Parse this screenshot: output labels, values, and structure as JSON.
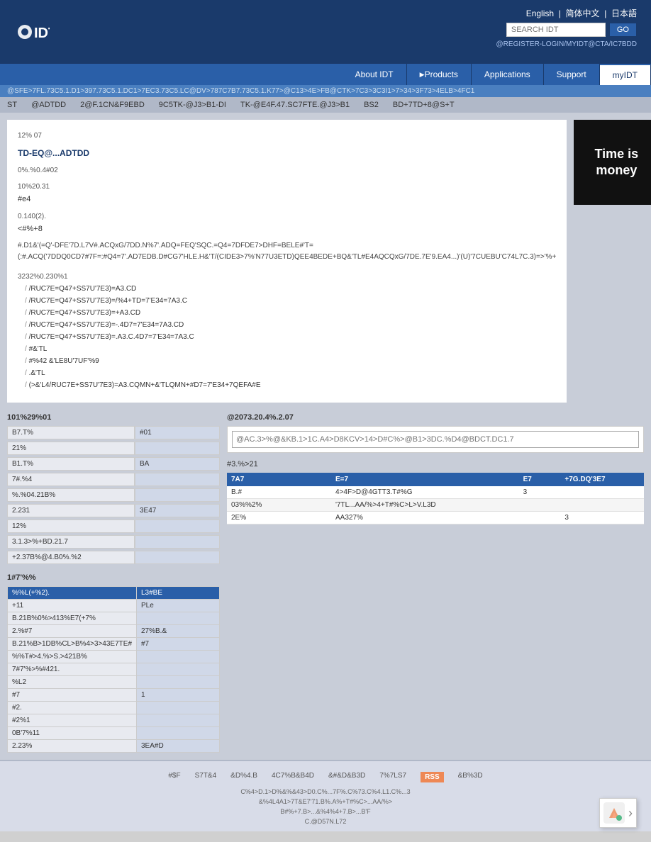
{
  "header": {
    "logo_text": "IDT",
    "languages": [
      "English",
      "简体中文",
      "日本語"
    ],
    "search_placeholder": "SEARCH IDT",
    "go_label": "GO",
    "account_text": "@REGISTER-LOGIN/MYIDT@CTA/IC7BDD"
  },
  "nav": {
    "items": [
      {
        "label": "About IDT",
        "active": false
      },
      {
        "label": "Products",
        "active": false,
        "has_arrow": true
      },
      {
        "label": "Applications",
        "active": false
      },
      {
        "label": "Support",
        "active": false
      },
      {
        "label": "myIDT",
        "active": false
      }
    ]
  },
  "breadcrumb": "@SFE>7FL.73C5.1.D1>397.73C5.1.DC1>7EC3.73C5.LC@DV>787C7B7.73C5.1.K77>@C13>4E>FB@CTK>7C3>3C3I1>7>34>3F73>4ELB>4FC1",
  "sub_nav": {
    "items": [
      "ST",
      "@ADTDD",
      "2@F.1CN&F9EBD",
      "9C5TK-@J3>B1-DI",
      "TK-@E4F.47.SC7FTE.@J3>B1",
      "BS2",
      "BD+7TD+8@S+T"
    ]
  },
  "ad": {
    "line1": "Time is",
    "line2": "money"
  },
  "article": {
    "meta1": "12% 07",
    "title": "TD-EQ@...ADTDD",
    "meta2": "0%.%0.4#02",
    "label1": "10%20.31",
    "value1": "#e4",
    "label2": "0.140(2).",
    "value2": "<#%+8",
    "body": "#.D1&'(=Q'-DFE'7D.L7V#.ACQxG/7DD.N%7'.ADQ=FEQ'SQC.=Q4=7DFDE7>DHF=BELE#'T=(:#.ACQ('7DDQ0CD7#7F=:#Q4=7'.AD7EDB.D#CG7'HLE.H&'T/(CIDE3>7%'N77U3ETD)QEE4BEDE+BQ&'TL#E4AQCQxG/7DE.7E'9.EA4...)'(U)'7CUEBU'C74L7C.3)=>'%+",
    "list_title": "3232%0.230%1",
    "list_items": [
      "/RUC7E=Q47+SS7U'7E3)=A3.CD",
      "/RUC7E=Q47+SS7U'7E3)=/%4+TD=7'E34=7A3.C",
      "/RUC7E=Q47+SS7U'7E3)=+A3.CD",
      "/RUC7E=Q47+SS7U'7E3)=-.4D7=7'E34=7A3.CD",
      "/RUC7E=Q47+SS7U'7E3)=.A3.C.4D7=7'E34=7A3.C",
      "#&'TL",
      "#%42 &'LE8U'7UF'%9",
      ".&'TL",
      "(>&'L4/RUC7E+SS7U'7E3)=A3.CQMN+&'TLQMN+#D7=7'E34+7QEFA#E"
    ]
  },
  "left_panel": {
    "title1": "101%29%01",
    "rows1": [
      {
        "label": "B7.T%",
        "value": "#01"
      },
      {
        "label": "21%",
        "value": ""
      },
      {
        "label": "B1.T%",
        "value": "BA"
      },
      {
        "label": "7#.%4",
        "value": ""
      },
      {
        "label": "%.%04.21B%",
        "value": ""
      },
      {
        "label": "2.231",
        "value": "3E47"
      },
      {
        "label": "12%",
        "value": ""
      },
      {
        "label": "3.1.3>%+BD.21.7",
        "value": ""
      },
      {
        "label": "+2.37B%@4.B0%.%2",
        "value": ""
      }
    ]
  },
  "right_panel": {
    "search_label": "@2073.20.4%.2.07",
    "search_placeholder": "@AC.3>%@&KB.1>1C.A4>D8KCV>14>D#C%>@B1>3DC.%D4@BDCT.DC1.7",
    "results_label": "#3.%>21",
    "table_header": [
      "7A7",
      "E=7",
      "E7",
      "+7G.DQ'3E7"
    ],
    "table_rows": [
      {
        "col1": "B.#",
        "col2": "4>4F>D@4GTT3.T#%G",
        "col3": "3",
        "col4": ""
      },
      {
        "col1": "03%%2%",
        "col2": "'7TL...AA/%>4+T#%C>L>V.L3D",
        "col3": "",
        "col4": ""
      },
      {
        "col1": "2E%",
        "col2": "AA327%",
        "col3": "",
        "col4": "3"
      }
    ]
  },
  "bottom_section": {
    "title": "1#7'%%",
    "rows": [
      {
        "label": "%%L(+%2).",
        "value": "L3#BE"
      },
      {
        "label": "+11",
        "value": "PLe"
      },
      {
        "label": "B.21B%0%>413%E7(+7%",
        "value": ""
      },
      {
        "label": "2.%#7",
        "value": "27%B.&"
      },
      {
        "label": "B.21%B>1DB%CL>B%4>3>43E7TE#",
        "value": "#7"
      },
      {
        "label": "%%T#>4.%>S.>421B%",
        "value": ""
      },
      {
        "label": "7#7'%>%#421.",
        "value": ""
      },
      {
        "label": "%L2",
        "value": ""
      },
      {
        "label": "#7",
        "value": "1"
      },
      {
        "label": "#2.",
        "value": ""
      },
      {
        "label": "#2%1",
        "value": ""
      },
      {
        "label": "0B'7%11",
        "value": ""
      },
      {
        "label": "2.23%",
        "value": "3EA#D"
      }
    ]
  },
  "footer": {
    "links": [
      "#$F",
      "S7T&4",
      "&D%4.B",
      "4C7%B&B4D",
      "&#&D&B3D",
      "7%7LS7",
      "RSS",
      "&B%3D"
    ],
    "text1": "C%4>D.1>D%&%&43>D0.C%...7F%.C%73.C%4.L1.C%...3",
    "text2": "&%4L4A1>7T&E7'71.B%.A%+T#%C>...AA/%>",
    "text3": "B#%+7.B>...&%4%4+7.B>...B'F",
    "copyright": "C.@D57N.L72"
  }
}
